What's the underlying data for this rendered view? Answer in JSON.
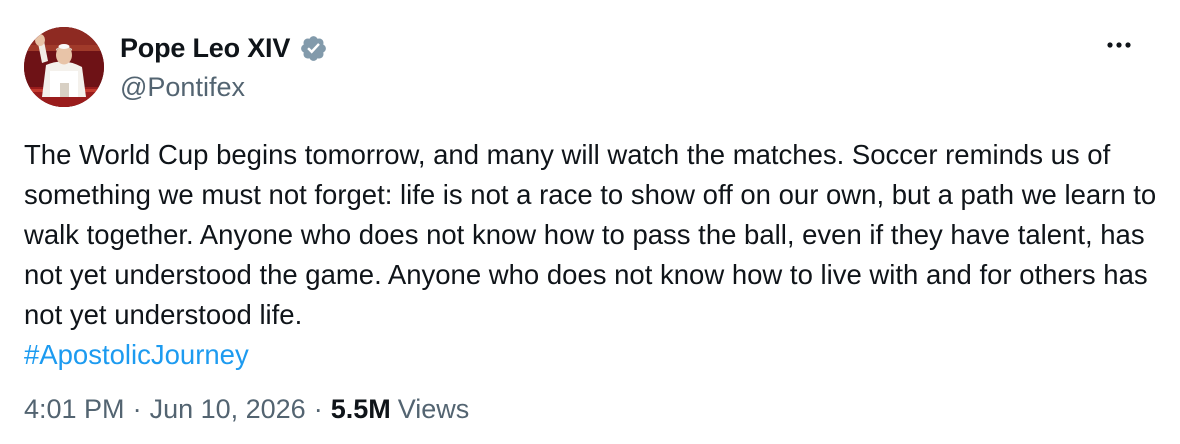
{
  "author": {
    "display_name": "Pope Leo XIV",
    "handle": "@Pontifex",
    "verified": true
  },
  "post": {
    "text": "The World Cup begins tomorrow, and many will watch the matches. Soccer reminds us of something we must not forget: life is not a race to show off on our own, but a path we learn to walk together. Anyone who does not know how to pass the ball, even if they have talent, has not yet understood the game. Anyone who does not know how to live with and for others has not yet understood life.",
    "hashtag": "#ApostolicJourney"
  },
  "meta": {
    "time": "4:01 PM",
    "separator": "·",
    "date": "Jun 10, 2026",
    "views_count": "5.5M",
    "views_label": "Views"
  },
  "icons": {
    "verified": "verified-badge-icon",
    "more": "more-options-icon"
  },
  "colors": {
    "text": "#0f1419",
    "secondary": "#536471",
    "link": "#1d9bf0",
    "verified_badge": "#829aab"
  }
}
